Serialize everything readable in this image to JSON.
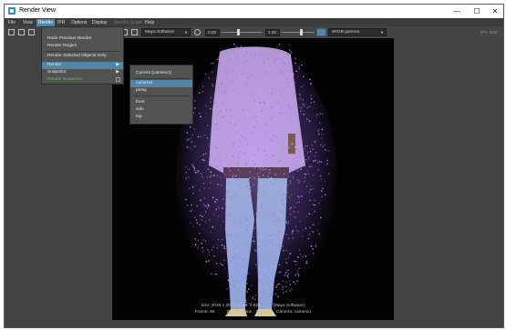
{
  "window": {
    "title": "Render View",
    "controls": {
      "minimize": "—",
      "maximize": "☐",
      "close": "✕"
    }
  },
  "menubar": {
    "items": [
      "File",
      "View",
      "Render",
      "IPR",
      "Options",
      "Display",
      "Render Script",
      "Help"
    ],
    "active": "Render",
    "disabled": "Render Script"
  },
  "toolbar": {
    "renderer": "Maya Software",
    "exposure": "0.00",
    "gamma": "1.00",
    "color_space": "sRGB gamma",
    "status": "IPR: 0MB"
  },
  "render_menu": {
    "items": [
      "Redo Previous Render",
      "Render Region",
      "Render Selected Objects Only",
      "Render",
      "Snapshot",
      "Render Sequence"
    ],
    "highlighted": "Render"
  },
  "camera_submenu": {
    "items": [
      "Current (camera1)",
      "camera1",
      "persp",
      "front",
      "side",
      "top"
    ],
    "highlighted": "camera1"
  },
  "render_info": {
    "size": "size: 2048 x 2048 zoom: 0.521",
    "renderer": "(Maya Software)",
    "frame": "Frame: 86",
    "render_time": "Render Time : 1:04",
    "camera": "Camera: camera1"
  },
  "colors": {
    "accent": "#5285a6",
    "background": "#444444",
    "viewport": "#030303",
    "figure": "#cfa2f5",
    "highlight_text": "#4fd14f"
  },
  "icons": [
    "render-view-app-icon",
    "open-image-icon",
    "save-image-icon",
    "render-region-icon",
    "snapshot-icon",
    "keep-image-icon"
  ]
}
